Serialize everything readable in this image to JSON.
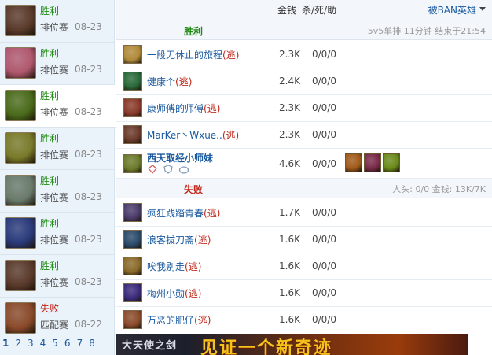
{
  "sidebar": {
    "matches": [
      {
        "result": "胜利",
        "mode": "排位赛",
        "date": "08-23",
        "avatar_color": "#5a3a2a"
      },
      {
        "result": "胜利",
        "mode": "排位赛",
        "date": "08-23",
        "avatar_color": "#b0586e"
      },
      {
        "result": "胜利",
        "mode": "排位赛",
        "date": "08-23",
        "avatar_color": "#4a6a1a"
      },
      {
        "result": "胜利",
        "mode": "排位赛",
        "date": "08-23",
        "avatar_color": "#7a7a2a"
      },
      {
        "result": "胜利",
        "mode": "排位赛",
        "date": "08-23",
        "avatar_color": "#6a7a6a"
      },
      {
        "result": "胜利",
        "mode": "排位赛",
        "date": "08-23",
        "avatar_color": "#2a3a7a"
      },
      {
        "result": "胜利",
        "mode": "排位赛",
        "date": "08-23",
        "avatar_color": "#5a3a2a"
      },
      {
        "result": "失败",
        "mode": "匹配赛",
        "date": "08-22",
        "avatar_color": "#8a4a2a"
      }
    ],
    "pages": [
      "1",
      "2",
      "3",
      "4",
      "5",
      "6",
      "7",
      "8"
    ]
  },
  "header": {
    "gold": "金钱",
    "kda": "杀/死/助",
    "ban": "被BAN英雄"
  },
  "team_win": {
    "label": "胜利",
    "info": "5v5单排  11分钟  结束于21:54",
    "players": [
      {
        "name": "一段无休止的旅程",
        "flee": "(逃)",
        "gold": "2.3K",
        "kda": "0/0/0",
        "color": "#b08a3a"
      },
      {
        "name": "健康个",
        "flee": "(逃)",
        "gold": "2.4K",
        "kda": "0/0/0",
        "color": "#2a6a3a"
      },
      {
        "name": "康师傅的师傅",
        "flee": "(逃)",
        "gold": "2.3K",
        "kda": "0/0/0",
        "color": "#8a3a2a"
      },
      {
        "name": "MarKer丶Wxue..",
        "flee": "(逃)",
        "gold": "2.3K",
        "kda": "0/0/0",
        "color": "#6a3a2a"
      },
      {
        "name": "西天取经小师妹",
        "flee": "",
        "gold": "4.6K",
        "kda": "0/0/0",
        "color": "#6a7a2a"
      }
    ]
  },
  "team_lose": {
    "label": "失败",
    "info": "人头: 0/0  金钱: 13K/7K",
    "players": [
      {
        "name": "疯狂践踏青春",
        "flee": "(逃)",
        "gold": "1.7K",
        "kda": "0/0/0",
        "color": "#4a3a6a"
      },
      {
        "name": "浪客拔刀斋",
        "flee": "(逃)",
        "gold": "1.6K",
        "kda": "0/0/0",
        "color": "#2a4a6a"
      },
      {
        "name": "唉我别走",
        "flee": "(逃)",
        "gold": "1.6K",
        "kda": "0/0/0",
        "color": "#8a6a2a"
      },
      {
        "name": "梅州小勋",
        "flee": "(逃)",
        "gold": "1.6K",
        "kda": "0/0/0",
        "color": "#3a2a7a"
      },
      {
        "name": "万恶的肥仔",
        "flee": "(逃)",
        "gold": "1.6K",
        "kda": "0/0/0",
        "color": "#8a4a2a"
      }
    ]
  },
  "items": [
    {
      "name": "item-icon",
      "color": "#a05a1a"
    },
    {
      "name": "item-icon",
      "color": "#7a2a4a"
    },
    {
      "name": "item-icon",
      "color": "#6a8a1a"
    }
  ],
  "honors": [
    "honor-icon-1",
    "honor-icon-2",
    "honor-icon-3"
  ],
  "banner": {
    "left": "大天使之剑",
    "main": "见证一个新奇迹"
  }
}
